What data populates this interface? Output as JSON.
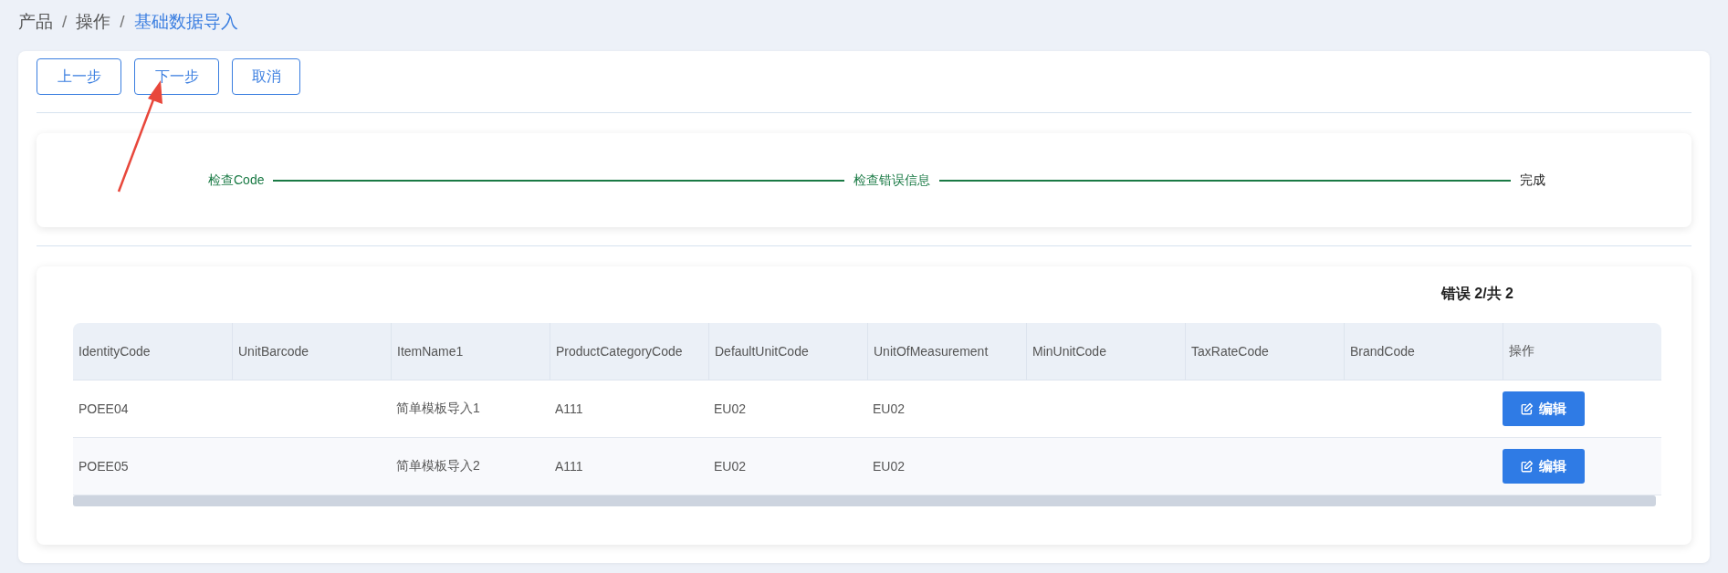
{
  "breadcrumb": [
    {
      "label": "产品",
      "current": false
    },
    {
      "label": "操作",
      "current": false
    },
    {
      "label": "基础数据导入",
      "current": true
    }
  ],
  "breadcrumb_separator": "/",
  "buttons": [
    "上一步",
    "下一步",
    "取消"
  ],
  "steps": [
    {
      "label": "检查Code",
      "done": true
    },
    {
      "label": "检查错误信息",
      "done": true
    },
    {
      "label": "完成",
      "done": false
    }
  ],
  "error_summary": "错误 2/共 2",
  "table": {
    "columns": [
      "IdentityCode",
      "UnitBarcode",
      "ItemName1",
      "ProductCategoryCode",
      "DefaultUnitCode",
      "UnitOfMeasurement",
      "MinUnitCode",
      "TaxRateCode",
      "BrandCode",
      "操作"
    ],
    "rows": [
      {
        "cells": [
          "POEE04",
          "",
          "简单模板导入1",
          "A111",
          "EU02",
          "EU02",
          "",
          "",
          ""
        ],
        "action": "编辑"
      },
      {
        "cells": [
          "POEE05",
          "",
          "简单模板导入2",
          "A111",
          "EU02",
          "EU02",
          "",
          "",
          ""
        ],
        "action": "编辑"
      }
    ]
  }
}
